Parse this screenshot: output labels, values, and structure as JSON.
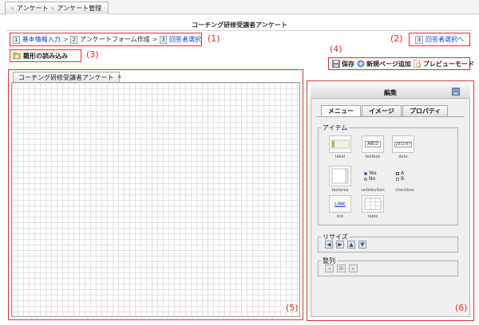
{
  "breadcrumb": {
    "items": [
      "アンケート",
      "アンケート管理"
    ]
  },
  "page": {
    "title": "コーチング研修受講者アンケート"
  },
  "steps": [
    {
      "num": "1",
      "label": "基本情報入力",
      "link": true
    },
    {
      "num": "2",
      "label": "アンケートフォーム作成",
      "link": false
    },
    {
      "num": "3",
      "label": "回答者選択",
      "link": true
    }
  ],
  "step_sep": ">",
  "next_step": {
    "num": "3",
    "label": "回答者選択へ"
  },
  "load_template": {
    "label": "雛形の読み込み"
  },
  "toolbar": {
    "save": "保存",
    "new_page": "新規ページ追加",
    "preview": "プレビューモード"
  },
  "canvas": {
    "tab_label": "コーチング研修受講者アンケート",
    "close": "✕"
  },
  "editor": {
    "title": "編集",
    "tabs": [
      "メニュー",
      "イメージ",
      "プロパティ"
    ],
    "items_group": "アイテム",
    "items": [
      {
        "name": "label",
        "text": ""
      },
      {
        "name": "textbox",
        "text": "ABCD"
      },
      {
        "name": "date",
        "text": "2011/07"
      },
      {
        "name": "textarea",
        "text": ""
      },
      {
        "name": "radiobutton",
        "opt1": "Yes",
        "opt2": "No"
      },
      {
        "name": "checkbox",
        "opt1": "A",
        "opt2": "B"
      },
      {
        "name": "link",
        "text": "LINK"
      },
      {
        "name": "table",
        "text": ""
      }
    ],
    "resize_group": "リサイズ",
    "align_group": "整列"
  },
  "annotations": [
    "(1)",
    "(2)",
    "(3)",
    "(4)",
    "(5)",
    "(6)"
  ],
  "colors": {
    "annotation": "#e03030",
    "link": "#1a44c4"
  }
}
